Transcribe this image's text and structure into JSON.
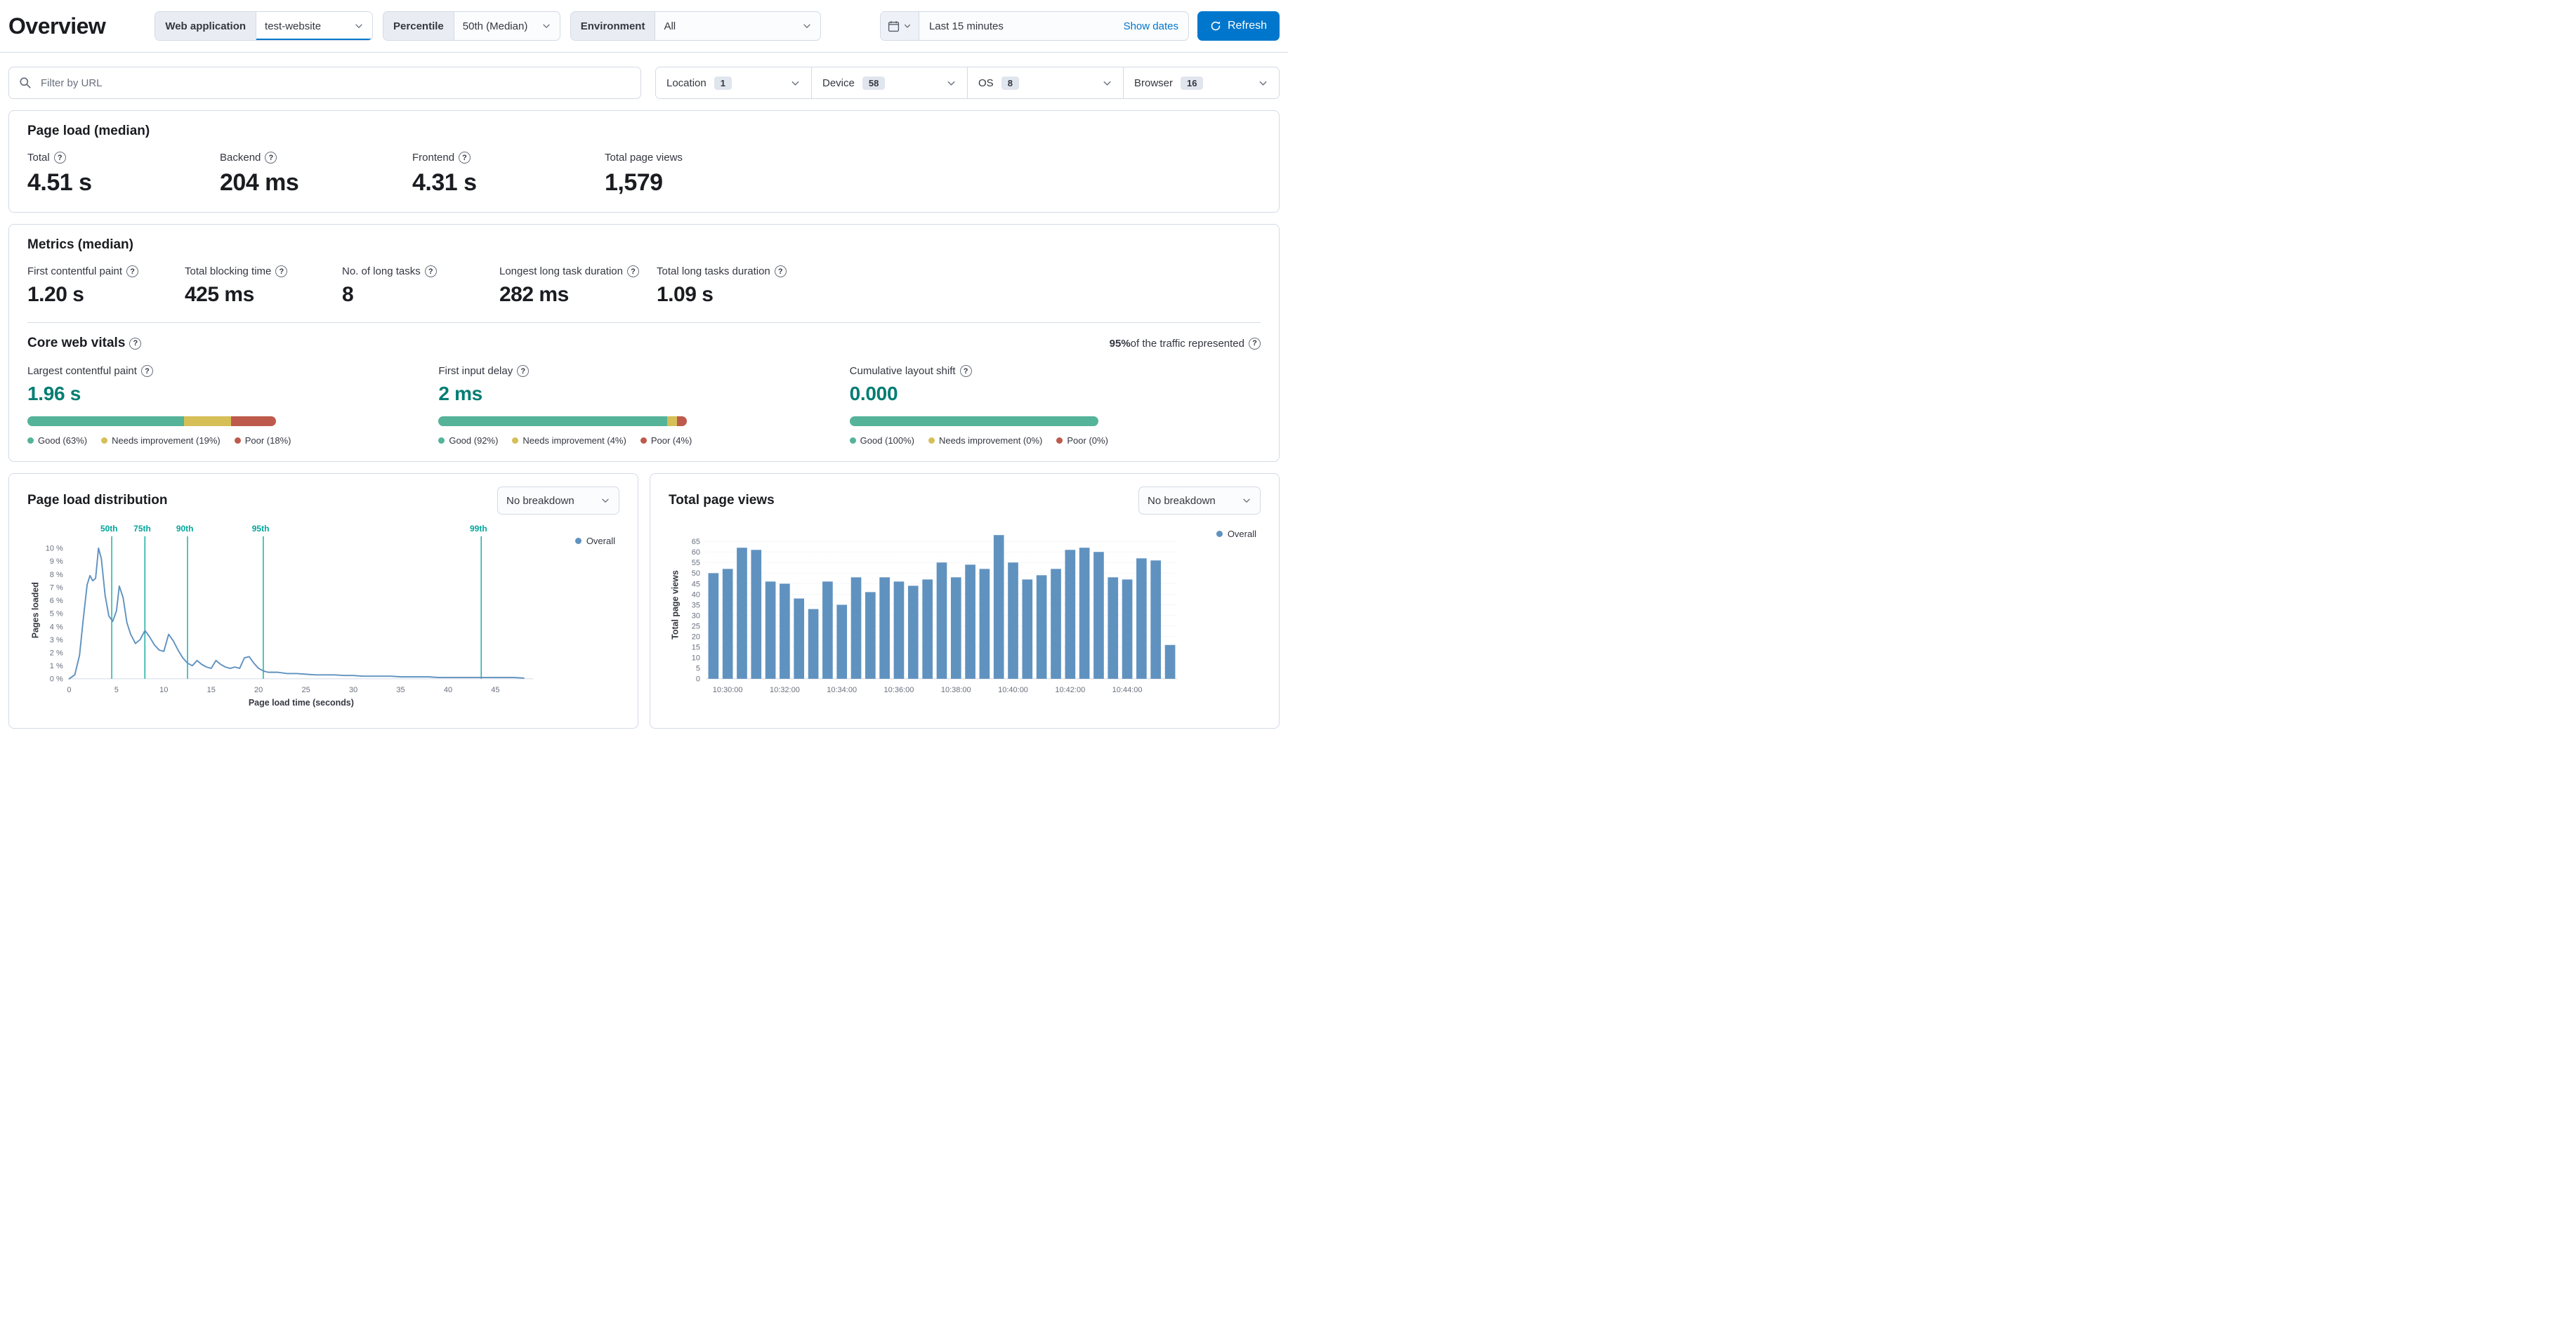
{
  "colors": {
    "accent": "#0077CC",
    "good": "#54B399",
    "ni": "#D6BF57",
    "poor": "#BE5A4C",
    "bar": "#6092C0",
    "percentile": "#00A69B",
    "cwv": "#017D73"
  },
  "page": {
    "title": "Overview"
  },
  "toolbar": {
    "web_app": {
      "label": "Web application",
      "value": "test-website"
    },
    "percentile": {
      "label": "Percentile",
      "value": "50th (Median)"
    },
    "environment": {
      "label": "Environment",
      "value": "All"
    },
    "time_range": {
      "value": "Last 15 minutes",
      "show_dates": "Show dates",
      "refresh": "Refresh"
    }
  },
  "filters": {
    "search_placeholder": "Filter by URL",
    "facets": [
      {
        "label": "Location",
        "count": "1"
      },
      {
        "label": "Device",
        "count": "58"
      },
      {
        "label": "OS",
        "count": "8"
      },
      {
        "label": "Browser",
        "count": "16"
      }
    ]
  },
  "page_load": {
    "title": "Page load (median)",
    "stats": [
      {
        "label": "Total",
        "value": "4.51 s"
      },
      {
        "label": "Backend",
        "value": "204 ms"
      },
      {
        "label": "Frontend",
        "value": "4.31 s"
      },
      {
        "label": "Total page views",
        "value": "1,579"
      }
    ]
  },
  "metrics": {
    "title": "Metrics (median)",
    "stats": [
      {
        "label": "First contentful paint",
        "value": "1.20 s"
      },
      {
        "label": "Total blocking time",
        "value": "425 ms"
      },
      {
        "label": "No. of long tasks",
        "value": "8"
      },
      {
        "label": "Longest long task duration",
        "value": "282 ms"
      },
      {
        "label": "Total long tasks duration",
        "value": "1.09 s"
      }
    ]
  },
  "cwv": {
    "title": "Core web vitals",
    "traffic_pct": "95%",
    "traffic_rest": " of the traffic represented",
    "metrics": [
      {
        "label": "Largest contentful paint",
        "value": "1.96 s",
        "good": 63,
        "ni": 19,
        "poor": 18,
        "legend": [
          "Good (63%)",
          "Needs improvement (19%)",
          "Poor (18%)"
        ]
      },
      {
        "label": "First input delay",
        "value": "2 ms",
        "good": 92,
        "ni": 4,
        "poor": 4,
        "legend": [
          "Good (92%)",
          "Needs improvement (4%)",
          "Poor (4%)"
        ]
      },
      {
        "label": "Cumulative layout shift",
        "value": "0.000",
        "good": 100,
        "ni": 0,
        "poor": 0,
        "legend": [
          "Good (100%)",
          "Needs improvement (0%)",
          "Poor (0%)"
        ]
      }
    ]
  },
  "chart_data": [
    {
      "type": "line",
      "title": "Page load distribution",
      "breakdown_label": "No breakdown",
      "xlabel": "Page load time (seconds)",
      "ylabel": "Pages loaded",
      "legend": [
        "Overall"
      ],
      "xlim": [
        0,
        49
      ],
      "ylim": [
        0,
        10.5
      ],
      "x_ticks": [
        0,
        5,
        10,
        15,
        20,
        25,
        30,
        35,
        40,
        45
      ],
      "y_ticks": [
        0,
        1,
        2,
        3,
        4,
        5,
        6,
        7,
        8,
        9,
        10
      ],
      "y_tick_suffix": " %",
      "percentiles": [
        {
          "label": "50th",
          "x": 4.5
        },
        {
          "label": "75th",
          "x": 8
        },
        {
          "label": "90th",
          "x": 12.5
        },
        {
          "label": "95th",
          "x": 20.5
        },
        {
          "label": "99th",
          "x": 43.5
        }
      ],
      "points": [
        [
          0,
          0
        ],
        [
          0.6,
          0.3
        ],
        [
          1.1,
          1.8
        ],
        [
          1.5,
          4.6
        ],
        [
          1.9,
          7.2
        ],
        [
          2.2,
          7.9
        ],
        [
          2.5,
          7.5
        ],
        [
          2.8,
          7.7
        ],
        [
          3.1,
          10
        ],
        [
          3.4,
          9.2
        ],
        [
          3.8,
          6.4
        ],
        [
          4.2,
          4.8
        ],
        [
          4.6,
          4.4
        ],
        [
          5,
          5.2
        ],
        [
          5.3,
          7.1
        ],
        [
          5.7,
          6.2
        ],
        [
          6.1,
          4.3
        ],
        [
          6.5,
          3.4
        ],
        [
          7,
          2.7
        ],
        [
          7.5,
          3
        ],
        [
          8,
          3.7
        ],
        [
          8.5,
          3.2
        ],
        [
          9,
          2.6
        ],
        [
          9.5,
          2.2
        ],
        [
          10,
          2.1
        ],
        [
          10.5,
          3.4
        ],
        [
          11,
          2.9
        ],
        [
          11.5,
          2.2
        ],
        [
          12,
          1.6
        ],
        [
          12.5,
          1.2
        ],
        [
          13,
          1
        ],
        [
          13.5,
          1.4
        ],
        [
          14,
          1.1
        ],
        [
          14.5,
          0.9
        ],
        [
          15,
          0.8
        ],
        [
          15.5,
          1.4
        ],
        [
          16,
          1.1
        ],
        [
          16.5,
          0.9
        ],
        [
          17,
          0.8
        ],
        [
          17.5,
          0.9
        ],
        [
          18,
          0.8
        ],
        [
          18.5,
          1.6
        ],
        [
          19,
          1.7
        ],
        [
          19.5,
          1.2
        ],
        [
          20,
          0.8
        ],
        [
          20.5,
          0.6
        ],
        [
          21,
          0.5
        ],
        [
          22,
          0.5
        ],
        [
          23,
          0.4
        ],
        [
          24,
          0.4
        ],
        [
          25,
          0.35
        ],
        [
          26,
          0.3
        ],
        [
          27,
          0.3
        ],
        [
          28,
          0.3
        ],
        [
          29,
          0.25
        ],
        [
          30,
          0.25
        ],
        [
          31,
          0.2
        ],
        [
          32,
          0.2
        ],
        [
          33,
          0.2
        ],
        [
          34,
          0.2
        ],
        [
          35,
          0.15
        ],
        [
          36,
          0.15
        ],
        [
          37,
          0.15
        ],
        [
          38,
          0.15
        ],
        [
          39,
          0.1
        ],
        [
          40,
          0.1
        ],
        [
          41,
          0.1
        ],
        [
          42,
          0.1
        ],
        [
          43,
          0.1
        ],
        [
          44,
          0.1
        ],
        [
          45,
          0.1
        ],
        [
          46,
          0.1
        ],
        [
          47,
          0.1
        ],
        [
          48,
          0.05
        ]
      ]
    },
    {
      "type": "bar",
      "title": "Total page views",
      "breakdown_label": "No breakdown",
      "ylabel": "Total page views",
      "legend": [
        "Overall"
      ],
      "ylim": [
        0,
        70
      ],
      "y_ticks": [
        0,
        5,
        10,
        15,
        20,
        25,
        30,
        35,
        40,
        45,
        50,
        55,
        60,
        65
      ],
      "values": [
        50,
        52,
        62,
        61,
        46,
        45,
        38,
        33,
        46,
        35,
        48,
        41,
        48,
        46,
        44,
        47,
        55,
        48,
        54,
        52,
        68,
        55,
        47,
        49,
        52,
        61,
        62,
        60,
        48,
        47,
        57,
        56,
        16
      ],
      "x_tick_indices": [
        1,
        5,
        9,
        13,
        17,
        21,
        25,
        29
      ],
      "x_tick_labels": [
        "10:30:00",
        "10:32:00",
        "10:34:00",
        "10:36:00",
        "10:38:00",
        "10:40:00",
        "10:42:00",
        "10:44:00"
      ]
    }
  ]
}
